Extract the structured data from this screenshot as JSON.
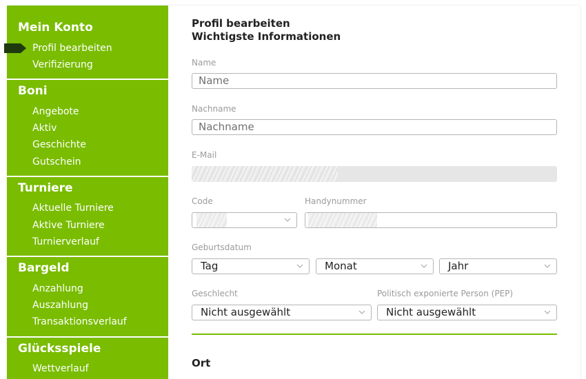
{
  "sidebar": {
    "sections": [
      {
        "title": "Mein Konto",
        "items": [
          "Profil bearbeiten",
          "Verifizierung"
        ]
      },
      {
        "title": "Boni",
        "items": [
          "Angebote",
          "Aktiv",
          "Geschichte",
          "Gutschein"
        ]
      },
      {
        "title": "Turniere",
        "items": [
          "Aktuelle Turniere",
          "Aktive Turniere",
          "Turnierverlauf"
        ]
      },
      {
        "title": "Bargeld",
        "items": [
          "Anzahlung",
          "Auszahlung",
          "Transaktionsverlauf"
        ]
      },
      {
        "title": "Glücksspiele",
        "items": [
          "Wettverlauf"
        ]
      }
    ],
    "active_item": "Profil bearbeiten"
  },
  "main": {
    "title": "Profil bearbeiten",
    "subtitle": "Wichtigste Informationen",
    "fields": {
      "name": {
        "label": "Name",
        "placeholder": "Name"
      },
      "nachname": {
        "label": "Nachname",
        "placeholder": "Nachname"
      },
      "email": {
        "label": "E-Mail"
      },
      "code": {
        "label": "Code"
      },
      "phone": {
        "label": "Handynummer"
      },
      "birthdate": {
        "label": "Geburtsdatum",
        "day": "Tag",
        "month": "Monat",
        "year": "Jahr"
      },
      "gender": {
        "label": "Geschlecht",
        "value": "Nicht ausgewählt"
      },
      "pep": {
        "label": "Politisch exponierte Person (PEP)",
        "value": "Nicht ausgewählt"
      }
    },
    "section_ort": "Ort"
  },
  "colors": {
    "sidebar_bg": "#79bc00",
    "active_marker": "#1f3a0f",
    "accent_line": "#79bc00"
  },
  "icons": [
    "chevron-down-icon",
    "active-arrow-icon"
  ]
}
